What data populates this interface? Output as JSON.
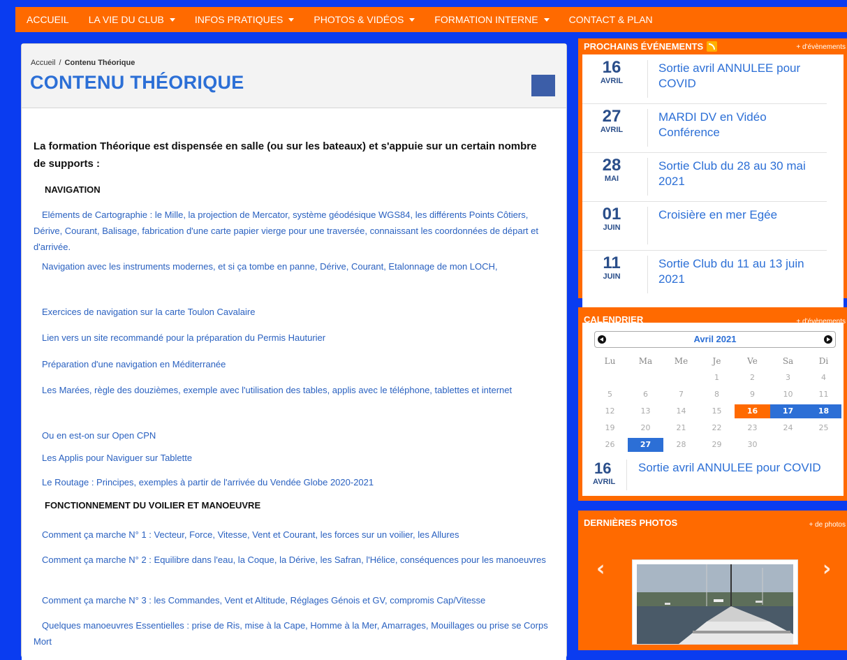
{
  "nav": {
    "items": [
      {
        "label": "ACCUEIL",
        "dropdown": false
      },
      {
        "label": "LA VIE DU CLUB",
        "dropdown": true
      },
      {
        "label": "INFOS PRATIQUES",
        "dropdown": true
      },
      {
        "label": "PHOTOS & VIDÉOS",
        "dropdown": true
      },
      {
        "label": "FORMATION INTERNE",
        "dropdown": true
      },
      {
        "label": "CONTACT & PLAN",
        "dropdown": false
      }
    ]
  },
  "breadcrumb": {
    "home": "Accueil",
    "separator": "/",
    "current": "Contenu Théorique"
  },
  "page_title": "CONTENU THÉORIQUE",
  "content": {
    "intro": "La formation Théorique est dispensée en salle (ou sur les bateaux) et s'appuie sur un certain nombre de supports :",
    "section_navigation": "NAVIGATION",
    "section_voilier": "FONCTIONNEMENT DU VOILIER ET MANOEUVRE",
    "nav_links": [
      "Eléments de Cartographie : le Mille, la projection de Mercator, système géodésique WGS84, les différents Points Côtiers, Dérive, Courant, Balisage, fabrication d'une carte papier vierge pour une traversée, connaissant les coordonnées de départ et d'arrivée.",
      "Navigation avec les instruments modernes, et si ça tombe en panne, Dérive, Courant, Etalonnage de mon LOCH,",
      "Exercices de navigation sur la carte Toulon Cavalaire",
      "Lien vers un site recommandé pour la préparation du Permis Hauturier",
      "Préparation d'une navigation en Méditerranée",
      "Les Marées, règle des douzièmes, exemple avec l'utilisation des tables, applis avec le téléphone, tablettes et internet",
      "Ou en est-on sur Open CPN",
      "Les Applis pour Naviguer sur Tablette",
      "Le Routage : Principes, exemples à partir de l'arrivée du Vendée Globe 2020-2021"
    ],
    "voilier_links": [
      "Comment ça marche N° 1 : Vecteur, Force, Vitesse, Vent et Courant, les forces sur un voilier, les Allures",
      "Comment ça marche N° 2 : Equilibre dans l'eau, la Coque, la Dérive, les Safran, l'Hélice, conséquences pour les manoeuvres",
      "Comment ça marche N° 3 : les Commandes, Vent et Altitude, Réglages Génois et GV, compromis Cap/Vitesse",
      "Quelques manoeuvres Essentielles : prise de Ris, mise à la Cape, Homme à la Mer, Amarrages, Mouillages ou prise se Corps Mort"
    ]
  },
  "sidebar": {
    "events": {
      "heading": "PROCHAINS ÉVÉNEMENTS",
      "more": "+ d'évènements",
      "rss_icon": "rss-icon",
      "items": [
        {
          "day": "16",
          "month": "AVRIL",
          "title": "Sortie avril ANNULEE pour COVID"
        },
        {
          "day": "27",
          "month": "AVRIL",
          "title": "MARDI DV en Vidéo Conférence"
        },
        {
          "day": "28",
          "month": "MAI",
          "title": "Sortie Club du 28 au 30 mai 2021"
        },
        {
          "day": "01",
          "month": "JUIN",
          "title": "Croisière en mer Egée"
        },
        {
          "day": "11",
          "month": "JUIN",
          "title": "Sortie Club du 11 au 13 juin 2021"
        }
      ]
    },
    "calendar": {
      "heading": "CALENDRIER",
      "more": "+ d'évènements",
      "month": "Avril 2021",
      "weekdays": [
        "Lu",
        "Ma",
        "Me",
        "Je",
        "Ve",
        "Sa",
        "Di"
      ],
      "weeks": [
        [
          "",
          "",
          "",
          "1",
          "2",
          "3",
          "4"
        ],
        [
          "5",
          "6",
          "7",
          "8",
          "9",
          "10",
          "11"
        ],
        [
          "12",
          "13",
          "14",
          "15",
          "16",
          "17",
          "18"
        ],
        [
          "19",
          "20",
          "21",
          "22",
          "23",
          "24",
          "25"
        ],
        [
          "26",
          "27",
          "28",
          "29",
          "30",
          "",
          ""
        ]
      ],
      "highlight_orange": [
        "16"
      ],
      "highlight_blue": [
        "17",
        "18",
        "27"
      ],
      "event": {
        "day": "16",
        "month": "AVRIL",
        "title": "Sortie avril ANNULEE pour COVID"
      }
    },
    "photos": {
      "heading": "DERNIÈRES PHOTOS",
      "more": "+ de photos"
    }
  },
  "colors": {
    "accent": "#ff6a00",
    "background": "#0a3cf0",
    "link": "#2a61c0",
    "title": "#2c6fd6"
  }
}
